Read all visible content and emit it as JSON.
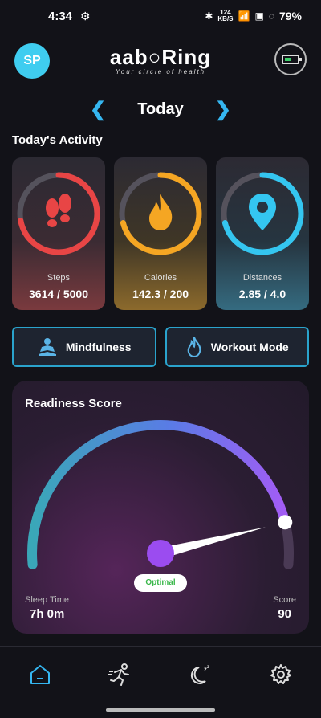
{
  "status_bar": {
    "time": "4:34",
    "speed_top": "124",
    "speed_bottom": "KB/S",
    "battery": "79%"
  },
  "header": {
    "avatar_initials": "SP",
    "logo_text": "aab○Ring",
    "tagline": "Your circle of health"
  },
  "date_nav": {
    "label": "Today",
    "prev": "❮",
    "next": "❯"
  },
  "activity": {
    "title": "Today's Activity",
    "cards": [
      {
        "label": "Steps",
        "value": "3614 / 5000",
        "progress": 0.72,
        "color": "#e84545"
      },
      {
        "label": "Calories",
        "value": "142.3 / 200",
        "progress": 0.71,
        "color": "#f5a623"
      },
      {
        "label": "Distances",
        "value": "2.85 / 4.0",
        "progress": 0.71,
        "color": "#34c6f0"
      }
    ]
  },
  "modes": {
    "mindfulness": "Mindfulness",
    "workout": "Workout Mode"
  },
  "readiness": {
    "title": "Readiness Score",
    "badge": "Optimal",
    "sleep_label": "Sleep Time",
    "sleep_value": "7h 0m",
    "score_label": "Score",
    "score_value": "90",
    "score_fraction": 0.9
  },
  "tabs": [
    "home-icon",
    "running-icon",
    "sleep-moon-icon",
    "gear-icon"
  ],
  "colors": {
    "accent": "#35b6f0",
    "gauge_start": "#3aa7b8",
    "gauge_end": "#9a5cf5",
    "needle": "#9b4cf0"
  }
}
